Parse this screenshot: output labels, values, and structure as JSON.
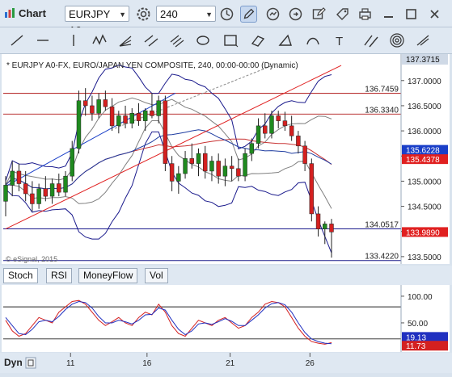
{
  "window": {
    "title": "Chart"
  },
  "toolbar": {
    "symbol": "EURJPY A0-",
    "interval": "240"
  },
  "panes": {
    "tabs": [
      "Stoch",
      "RSI",
      "MoneyFlow",
      "Vol"
    ]
  },
  "bottom": {
    "dyn_label": "Dyn"
  },
  "colors": {
    "background": "#ffffff",
    "up_candle": "#1f8a1f",
    "down_candle": "#d42020",
    "bb_outer": "#1a1a8c",
    "bb_inner": "#808080",
    "ma_red": "#c83232",
    "ma_blue": "#1e3ca0",
    "price_tag_blue": "#1a3fc8",
    "price_tag_red": "#e02020",
    "stoch_k": "#d42020",
    "stoch_d": "#2030c0"
  },
  "chart_data": [
    {
      "type": "candlestick",
      "title": "* EURJPY A0-FX, EURO/JAPAN YEN COMPOSITE, 240, 00:00-00:00 (Dynamic)",
      "watermark": "© eSignal, 2015",
      "x_tick_labels": [
        "11",
        "16",
        "21",
        "26"
      ],
      "y_tick_labels": [
        "137.0000",
        "136.5000",
        "136.0000",
        "135.5000",
        "135.0000",
        "134.5000",
        "134.0000",
        "133.5000"
      ],
      "ylim": [
        133.45,
        137.43
      ],
      "top_label": "137.3715",
      "horizontal_lines": [
        {
          "label": "136.7459",
          "value": 136.7459,
          "color": "#b01818"
        },
        {
          "label": "136.3340",
          "value": 136.334,
          "color": "#b01818"
        },
        {
          "label": "134.0517",
          "value": 134.0517,
          "color": "#1a1a8c"
        },
        {
          "label": "133.4220",
          "value": 133.422,
          "color": "#1a1a8c"
        }
      ],
      "price_tags": [
        {
          "label": "135.6228",
          "value": 135.6228,
          "color": "#1a3fc8"
        },
        {
          "label": "135.4378",
          "value": 135.4378,
          "color": "#e02020"
        },
        {
          "label": "133.9890",
          "value": 133.989,
          "color": "#e02020"
        }
      ],
      "candles": [
        {
          "o": 134.6,
          "h": 135.1,
          "l": 134.3,
          "c": 134.92
        },
        {
          "o": 134.92,
          "h": 135.4,
          "l": 134.7,
          "c": 135.2
        },
        {
          "o": 135.2,
          "h": 135.35,
          "l": 134.8,
          "c": 134.95
        },
        {
          "o": 134.95,
          "h": 135.2,
          "l": 134.6,
          "c": 134.75
        },
        {
          "o": 134.75,
          "h": 135.0,
          "l": 134.4,
          "c": 134.55
        },
        {
          "o": 134.55,
          "h": 134.95,
          "l": 134.45,
          "c": 134.85
        },
        {
          "o": 134.85,
          "h": 135.1,
          "l": 134.6,
          "c": 134.7
        },
        {
          "o": 134.7,
          "h": 135.05,
          "l": 134.55,
          "c": 134.95
        },
        {
          "o": 134.95,
          "h": 135.15,
          "l": 134.7,
          "c": 134.78
        },
        {
          "o": 134.78,
          "h": 135.2,
          "l": 134.7,
          "c": 135.1
        },
        {
          "o": 135.1,
          "h": 135.8,
          "l": 135.0,
          "c": 135.65
        },
        {
          "o": 135.65,
          "h": 136.8,
          "l": 135.55,
          "c": 136.6
        },
        {
          "o": 136.6,
          "h": 136.85,
          "l": 136.3,
          "c": 136.5
        },
        {
          "o": 136.5,
          "h": 136.7,
          "l": 136.2,
          "c": 136.35
        },
        {
          "o": 136.35,
          "h": 136.75,
          "l": 136.25,
          "c": 136.62
        },
        {
          "o": 136.62,
          "h": 136.8,
          "l": 136.4,
          "c": 136.48
        },
        {
          "o": 136.48,
          "h": 136.65,
          "l": 136.0,
          "c": 136.1
        },
        {
          "o": 136.1,
          "h": 136.4,
          "l": 135.95,
          "c": 136.3
        },
        {
          "o": 136.3,
          "h": 136.5,
          "l": 136.05,
          "c": 136.15
        },
        {
          "o": 136.15,
          "h": 136.45,
          "l": 136.05,
          "c": 136.35
        },
        {
          "o": 136.35,
          "h": 136.55,
          "l": 136.1,
          "c": 136.2
        },
        {
          "o": 136.2,
          "h": 136.45,
          "l": 136.0,
          "c": 136.4
        },
        {
          "o": 136.4,
          "h": 136.75,
          "l": 136.25,
          "c": 136.3
        },
        {
          "o": 136.3,
          "h": 136.7,
          "l": 136.15,
          "c": 136.6
        },
        {
          "o": 136.6,
          "h": 136.7,
          "l": 135.2,
          "c": 135.35
        },
        {
          "o": 135.35,
          "h": 135.5,
          "l": 134.8,
          "c": 135.0
        },
        {
          "o": 135.0,
          "h": 135.3,
          "l": 134.75,
          "c": 135.15
        },
        {
          "o": 135.15,
          "h": 135.6,
          "l": 135.05,
          "c": 135.45
        },
        {
          "o": 135.45,
          "h": 135.75,
          "l": 135.25,
          "c": 135.35
        },
        {
          "o": 135.35,
          "h": 135.65,
          "l": 135.1,
          "c": 135.55
        },
        {
          "o": 135.55,
          "h": 135.7,
          "l": 135.05,
          "c": 135.2
        },
        {
          "o": 135.2,
          "h": 135.5,
          "l": 135.0,
          "c": 135.4
        },
        {
          "o": 135.4,
          "h": 135.55,
          "l": 134.95,
          "c": 135.1
        },
        {
          "o": 135.1,
          "h": 135.45,
          "l": 134.9,
          "c": 135.3
        },
        {
          "o": 135.3,
          "h": 135.5,
          "l": 135.0,
          "c": 135.25
        },
        {
          "o": 135.25,
          "h": 135.45,
          "l": 135.0,
          "c": 135.1
        },
        {
          "o": 135.1,
          "h": 135.65,
          "l": 135.0,
          "c": 135.55
        },
        {
          "o": 135.55,
          "h": 135.85,
          "l": 135.4,
          "c": 135.75
        },
        {
          "o": 135.75,
          "h": 136.25,
          "l": 135.65,
          "c": 136.1
        },
        {
          "o": 136.1,
          "h": 136.35,
          "l": 135.85,
          "c": 135.95
        },
        {
          "o": 135.95,
          "h": 136.4,
          "l": 135.85,
          "c": 136.3
        },
        {
          "o": 136.3,
          "h": 136.4,
          "l": 136.05,
          "c": 136.2
        },
        {
          "o": 136.2,
          "h": 136.38,
          "l": 136.0,
          "c": 136.1
        },
        {
          "o": 136.1,
          "h": 136.3,
          "l": 135.8,
          "c": 135.9
        },
        {
          "o": 135.9,
          "h": 136.0,
          "l": 135.55,
          "c": 135.7
        },
        {
          "o": 135.7,
          "h": 135.8,
          "l": 135.2,
          "c": 135.35
        },
        {
          "o": 135.35,
          "h": 135.45,
          "l": 134.2,
          "c": 134.35
        },
        {
          "o": 134.35,
          "h": 134.5,
          "l": 133.9,
          "c": 134.05
        },
        {
          "o": 134.05,
          "h": 134.2,
          "l": 133.75,
          "c": 134.15
        },
        {
          "o": 134.15,
          "h": 134.25,
          "l": 133.48,
          "c": 133.99
        }
      ]
    },
    {
      "type": "line",
      "title": "Stoch",
      "y_tick_labels": [
        "100.00",
        "50.00"
      ],
      "ylim": [
        0,
        115
      ],
      "horizontal_lines": [
        80,
        20
      ],
      "value_tags": [
        "19.13",
        "11.73"
      ],
      "series": [
        {
          "values": [
            55,
            35,
            25,
            30,
            45,
            60,
            55,
            50,
            70,
            80,
            90,
            92,
            85,
            70,
            55,
            45,
            52,
            60,
            50,
            45,
            60,
            70,
            65,
            85,
            70,
            45,
            30,
            25,
            40,
            55,
            50,
            45,
            55,
            60,
            50,
            40,
            45,
            60,
            70,
            85,
            90,
            88,
            80,
            60,
            40,
            25,
            15,
            12,
            10,
            13
          ]
        },
        {
          "values": [
            60,
            45,
            30,
            28,
            38,
            52,
            55,
            52,
            62,
            75,
            85,
            90,
            88,
            78,
            62,
            50,
            50,
            55,
            52,
            48,
            55,
            65,
            66,
            78,
            74,
            55,
            38,
            28,
            35,
            48,
            50,
            47,
            52,
            58,
            53,
            45,
            45,
            55,
            65,
            78,
            86,
            88,
            84,
            70,
            50,
            32,
            20,
            15,
            12,
            11
          ]
        }
      ]
    }
  ]
}
